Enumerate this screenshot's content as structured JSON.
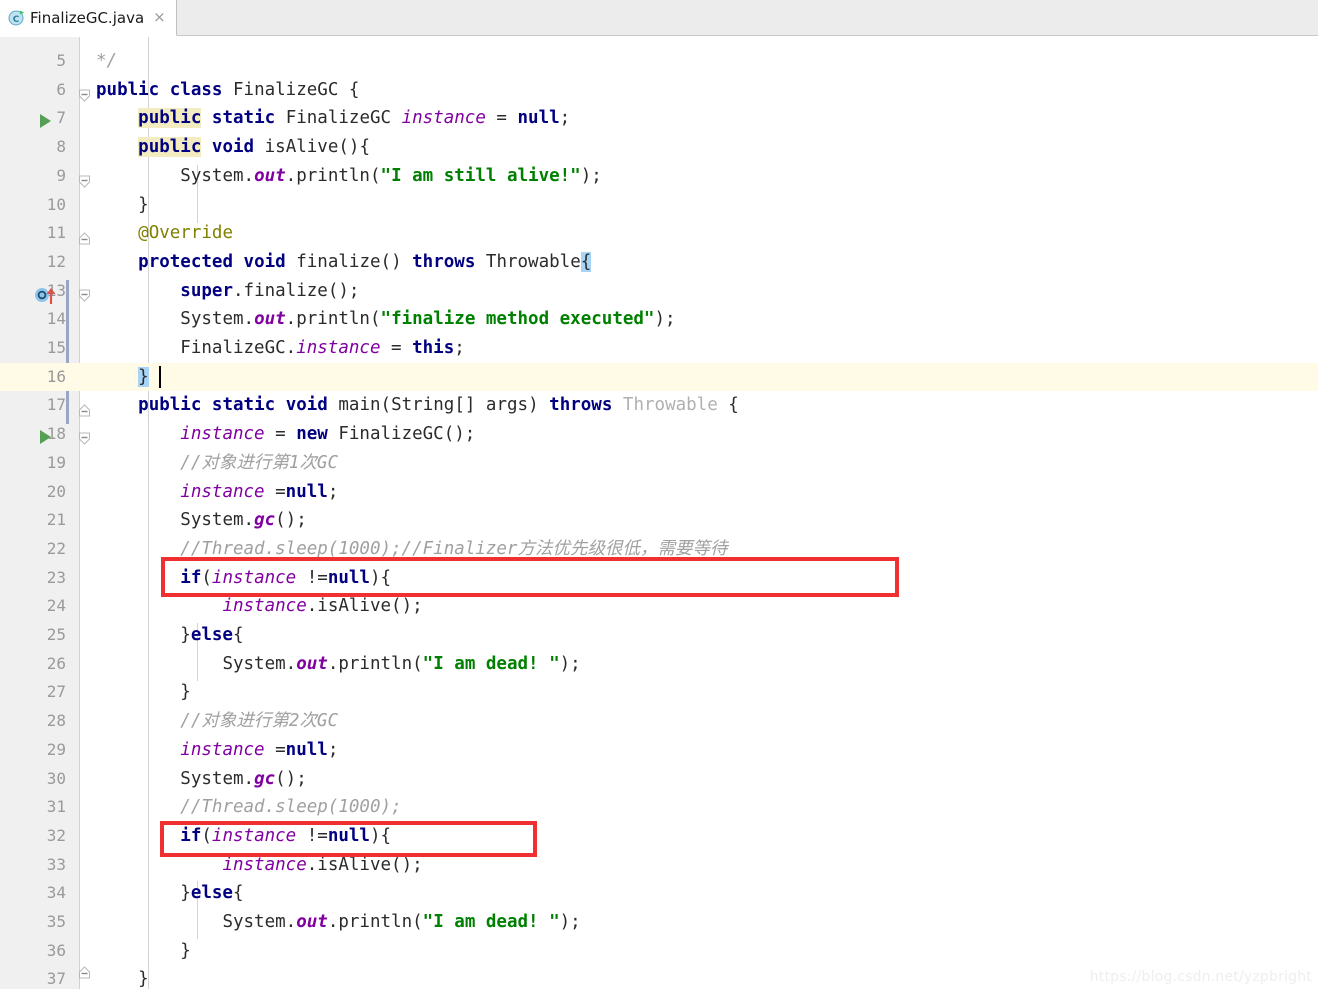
{
  "window": {
    "title": "FinalizeGC.java",
    "watermark": "https://blog.csdn.net/yzpbright"
  },
  "tab": {
    "label": "FinalizeGC.java",
    "icon": "java-class-icon",
    "close": "×"
  },
  "editor": {
    "first_visible_line": 5,
    "last_visible_line": 37,
    "current_line": 16,
    "caret_line": 16,
    "language": "Java",
    "colors": {
      "keyword": "#000080",
      "string": "#008000",
      "comment": "#a0a0a0",
      "field": "#8000a0",
      "annotation": "#808000",
      "identifier": "#2b2b2b",
      "grayed": "#b0b0b0",
      "search_highlight": "#f3ecc0",
      "brace_highlight": "#a8d4f5",
      "current_line_bg": "#fffbe6",
      "gutter_bg": "#f0f0f0",
      "change_bar": "#9aa7c4",
      "run_arrow": "#56a056",
      "annotation_box": "#f03030"
    },
    "gutter": {
      "run_marker_lines": [
        6,
        17
      ],
      "override_marker_lines": [
        12
      ],
      "fold_lines": [
        5,
        8,
        10,
        12,
        16,
        17,
        37
      ],
      "change_bar_range": [
        12,
        16
      ]
    },
    "annotations": [
      {
        "name": "red-box-1",
        "target_line": 22,
        "text": "//Thread.sleep(1000);//Finalizer方法优先级很低，需要等待"
      },
      {
        "name": "red-box-2",
        "target_line": 31,
        "text": "//Thread.sleep(1000);"
      }
    ],
    "lines": [
      {
        "n": 5,
        "plain": "*/"
      },
      {
        "n": 6,
        "plain": "public class FinalizeGC {"
      },
      {
        "n": 7,
        "plain": "    public static FinalizeGC instance = null;"
      },
      {
        "n": 8,
        "plain": "    public void isAlive(){"
      },
      {
        "n": 9,
        "plain": "        System.out.println(\"I am still alive!\");"
      },
      {
        "n": 10,
        "plain": "    }"
      },
      {
        "n": 11,
        "plain": "    @Override"
      },
      {
        "n": 12,
        "plain": "    protected void finalize() throws Throwable{"
      },
      {
        "n": 13,
        "plain": "        super.finalize();"
      },
      {
        "n": 14,
        "plain": "        System.out.println(\"finalize method executed\");"
      },
      {
        "n": 15,
        "plain": "        FinalizeGC.instance = this;"
      },
      {
        "n": 16,
        "plain": "    }"
      },
      {
        "n": 17,
        "plain": "    public static void main(String[] args) throws Throwable {"
      },
      {
        "n": 18,
        "plain": "        instance = new FinalizeGC();"
      },
      {
        "n": 19,
        "plain": "        //对象进行第1次GC"
      },
      {
        "n": 20,
        "plain": "        instance =null;"
      },
      {
        "n": 21,
        "plain": "        System.gc();"
      },
      {
        "n": 22,
        "plain": "        //Thread.sleep(1000);//Finalizer方法优先级很低，需要等待"
      },
      {
        "n": 23,
        "plain": "        if(instance !=null){"
      },
      {
        "n": 24,
        "plain": "            instance.isAlive();"
      },
      {
        "n": 25,
        "plain": "        }else{"
      },
      {
        "n": 26,
        "plain": "            System.out.println(\"I am dead! \");"
      },
      {
        "n": 27,
        "plain": "        }"
      },
      {
        "n": 28,
        "plain": "        //对象进行第2次GC"
      },
      {
        "n": 29,
        "plain": "        instance =null;"
      },
      {
        "n": 30,
        "plain": "        System.gc();"
      },
      {
        "n": 31,
        "plain": "        //Thread.sleep(1000);"
      },
      {
        "n": 32,
        "plain": "        if(instance !=null){"
      },
      {
        "n": 33,
        "plain": "            instance.isAlive();"
      },
      {
        "n": 34,
        "plain": "        }else{"
      },
      {
        "n": 35,
        "plain": "            System.out.println(\"I am dead! \");"
      },
      {
        "n": 36,
        "plain": "        }"
      },
      {
        "n": 37,
        "plain": "    }"
      }
    ]
  }
}
